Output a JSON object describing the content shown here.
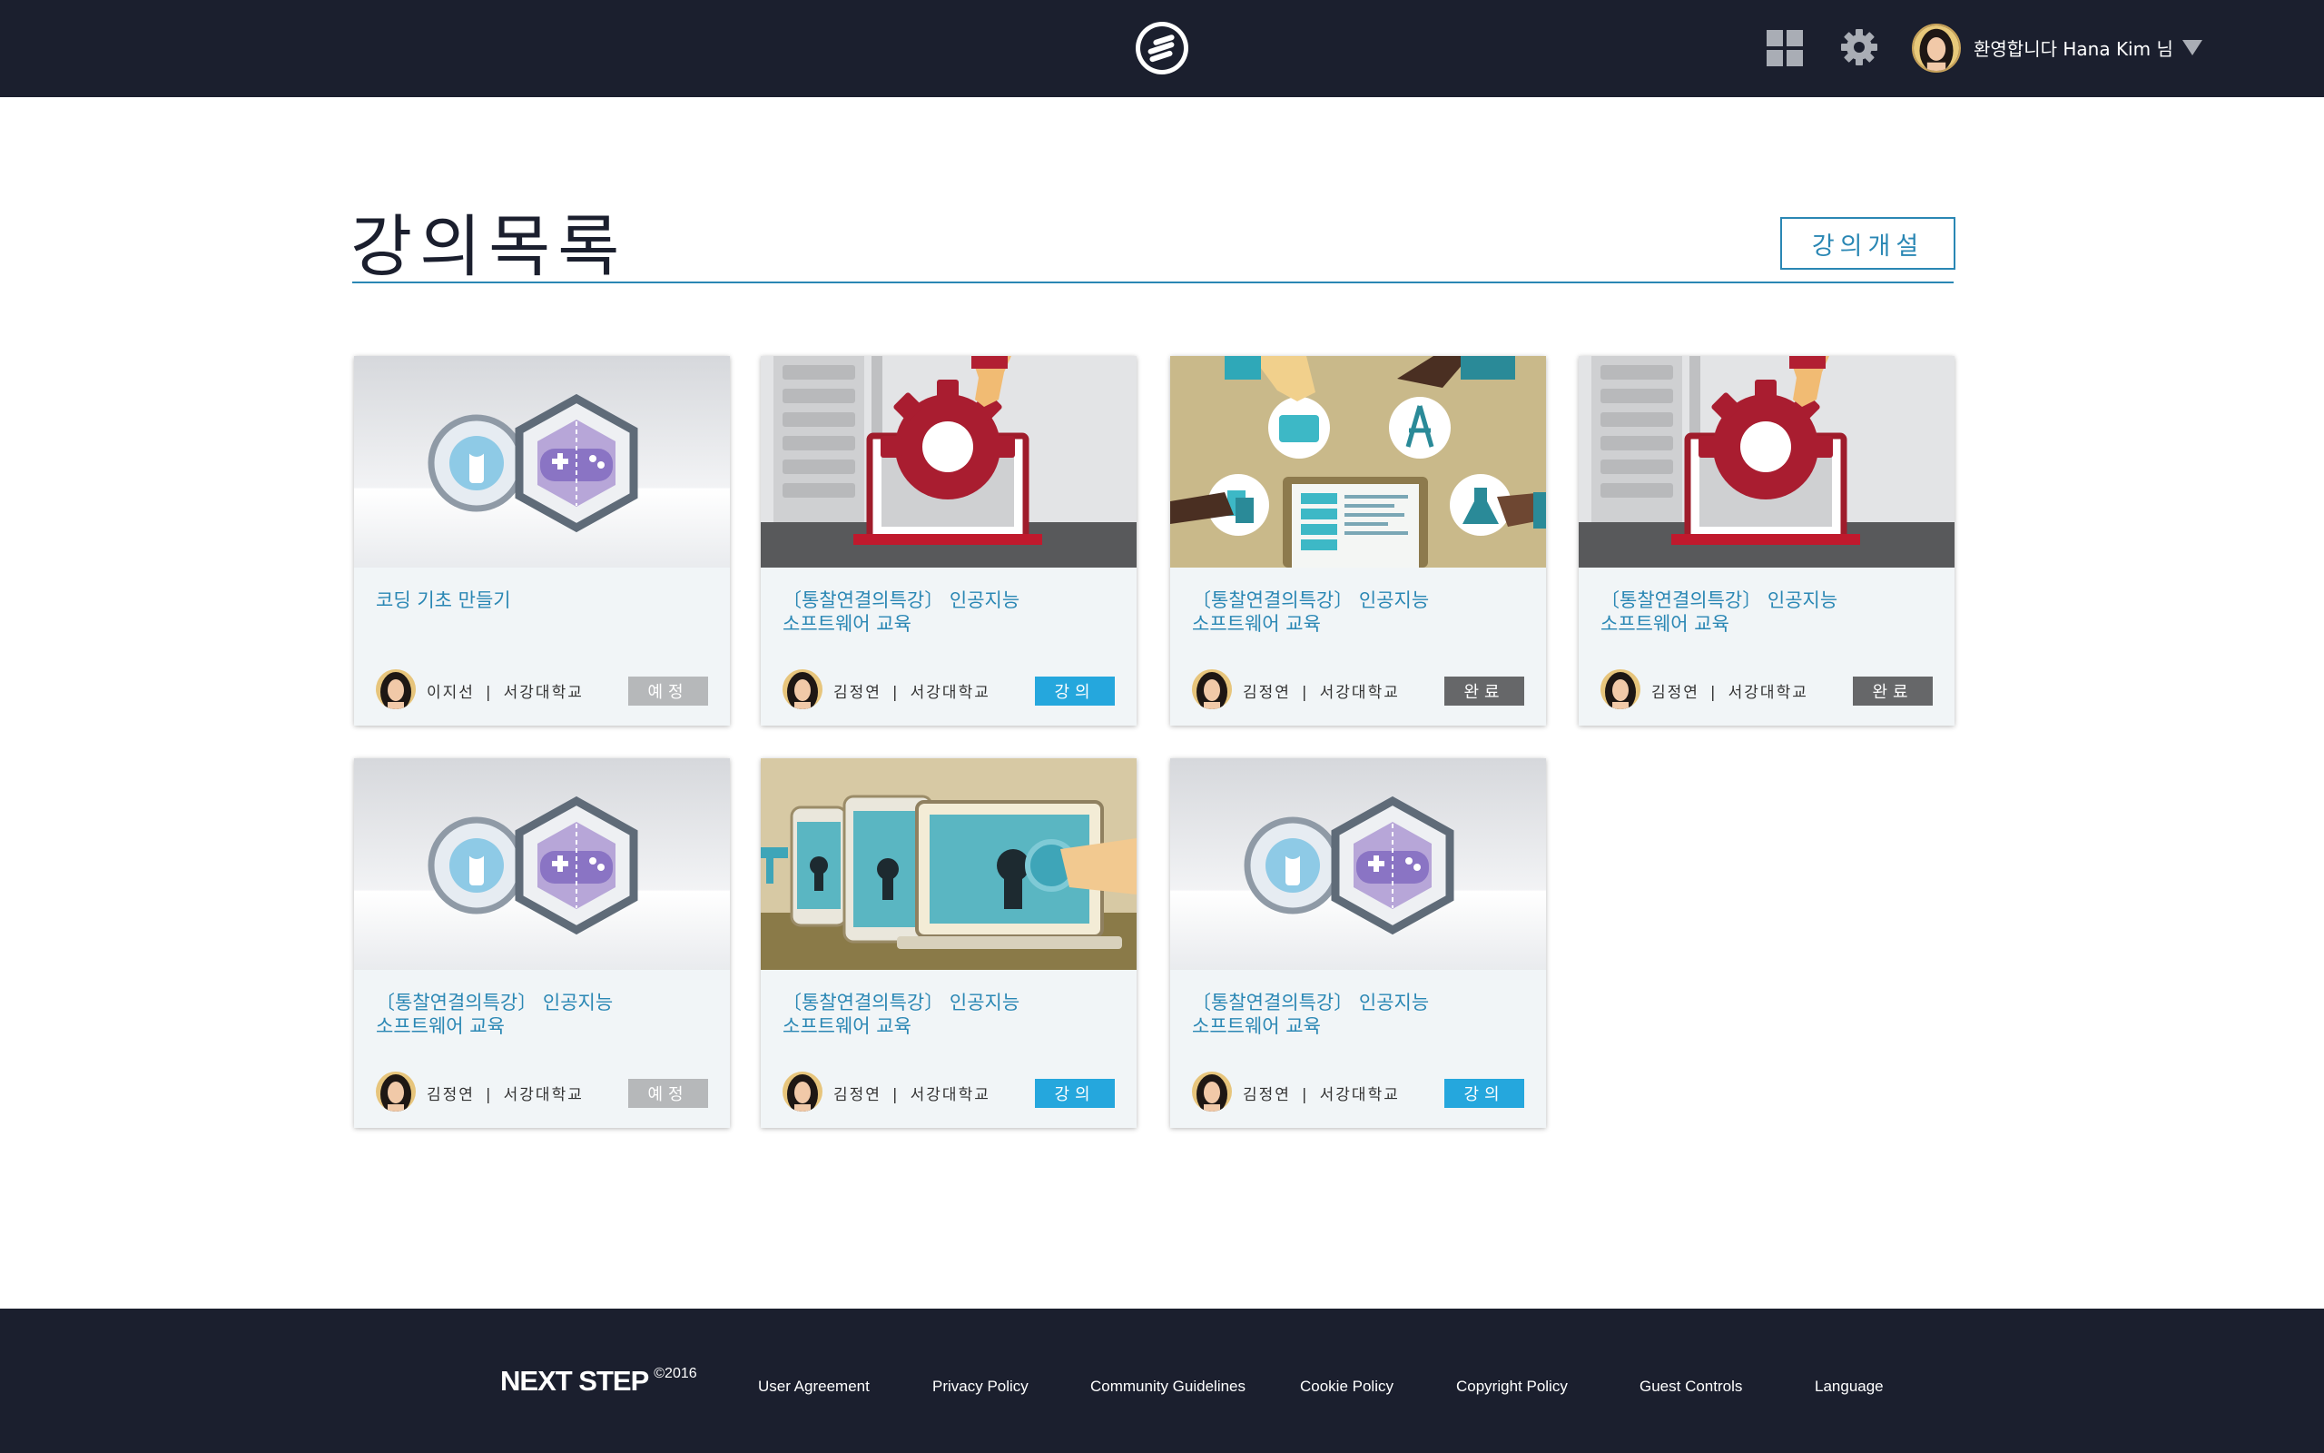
{
  "header": {
    "logo_icon": "brand-logo-icon",
    "apps_icon": "grid-icon",
    "settings_icon": "gear-icon",
    "welcome_text": "환영합니다 Hana Kim 님",
    "menu_icon": "caret-down-icon"
  },
  "main": {
    "title": "강의목록",
    "open_course_button": "강의개설",
    "accent_color": "#2a87b4"
  },
  "courses": [
    {
      "title_line1": "코딩 기초 만들기",
      "title_line2": "",
      "instructor": "이지선",
      "separator": "|",
      "school": "서강대학교",
      "status": "예정",
      "status_type": "scheduled",
      "thumbnail": "gamepad-badge"
    },
    {
      "title_line1": "〔통찰연결의특강〕 인공지능",
      "title_line2": "소프트웨어 교육",
      "instructor": "김정연",
      "separator": "|",
      "school": "서강대학교",
      "status": "강의",
      "status_type": "live",
      "thumbnail": "gear-laptop"
    },
    {
      "title_line1": "〔통찰연결의특강〕 인공지능",
      "title_line2": "소프트웨어 교육",
      "instructor": "김정연",
      "separator": "|",
      "school": "서강대학교",
      "status": "완료",
      "status_type": "done",
      "thumbnail": "hands-laptop"
    },
    {
      "title_line1": "〔통찰연결의특강〕 인공지능",
      "title_line2": "소프트웨어 교육",
      "instructor": "김정연",
      "separator": "|",
      "school": "서강대학교",
      "status": "완료",
      "status_type": "done",
      "thumbnail": "gear-laptop"
    },
    {
      "title_line1": "〔통찰연결의특강〕 인공지능",
      "title_line2": "소프트웨어 교육",
      "instructor": "김정연",
      "separator": "|",
      "school": "서강대학교",
      "status": "예정",
      "status_type": "scheduled",
      "thumbnail": "gamepad-badge"
    },
    {
      "title_line1": "〔통찰연결의특강〕 인공지능",
      "title_line2": "소프트웨어 교육",
      "instructor": "김정연",
      "separator": "|",
      "school": "서강대학교",
      "status": "강의",
      "status_type": "live",
      "thumbnail": "key-devices"
    },
    {
      "title_line1": "〔통찰연결의특강〕 인공지능",
      "title_line2": "소프트웨어 교육",
      "instructor": "김정연",
      "separator": "|",
      "school": "서강대학교",
      "status": "강의",
      "status_type": "live",
      "thumbnail": "gamepad-badge"
    }
  ],
  "status_colors": {
    "scheduled": "#b6b8ba",
    "live": "#25a7dd",
    "done": "#666769"
  },
  "footer": {
    "brand": "NEXT STEP",
    "copyright": "©2016",
    "links": [
      "User Agreement",
      "Privacy Policy",
      "Community Guidelines",
      "Cookie Policy",
      "Copyright Policy",
      "Guest Controls",
      "Language"
    ]
  }
}
